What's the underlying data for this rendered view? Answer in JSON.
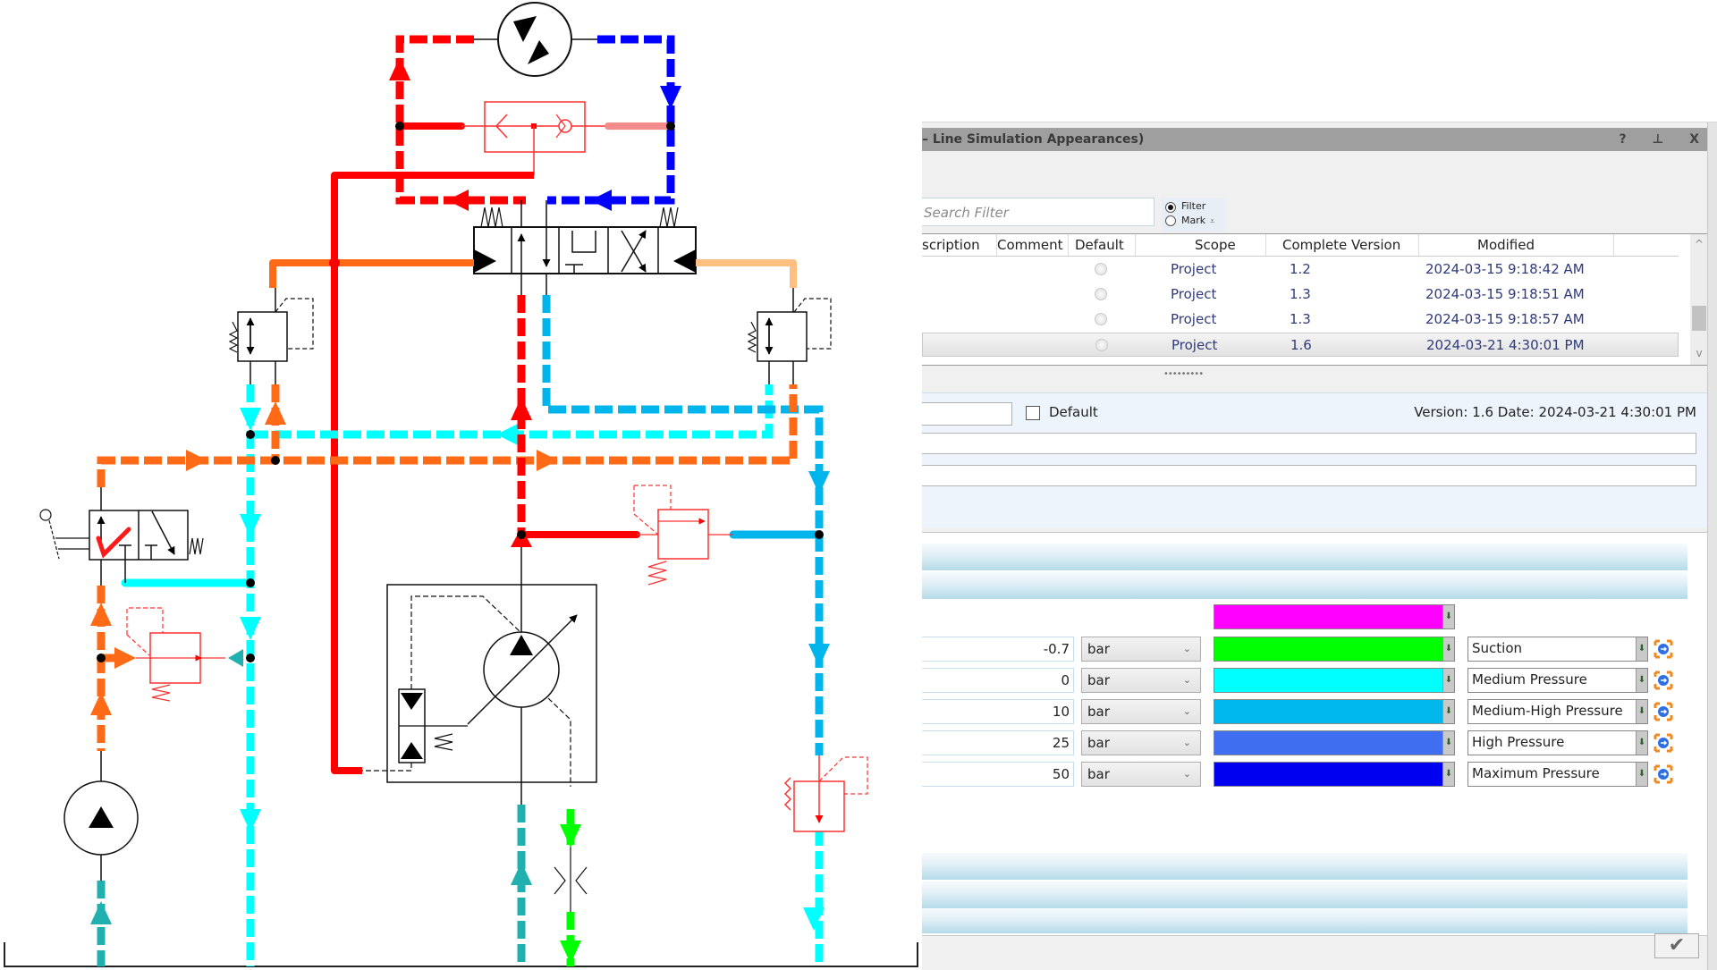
{
  "panel": {
    "title": "– Line Simulation Appearances)",
    "title_buttons": {
      "help": "?",
      "pin": "⊥",
      "close": "X"
    },
    "search": {
      "placeholder": "Search Filter"
    },
    "search_mode": {
      "filter_label": "Filter",
      "mark_label": "Mark",
      "selected": "Filter",
      "more_glyph": "⩡"
    },
    "grid": {
      "columns": [
        "scription",
        "Comment",
        "Default",
        "Scope",
        "Complete Version",
        "Modified"
      ],
      "rows": [
        {
          "default": false,
          "scope": "Project",
          "version": "1.2",
          "modified": "2024-03-15 9:18:42 AM",
          "selected": false
        },
        {
          "default": false,
          "scope": "Project",
          "version": "1.3",
          "modified": "2024-03-15 9:18:51 AM",
          "selected": false
        },
        {
          "default": false,
          "scope": "Project",
          "version": "1.3",
          "modified": "2024-03-15 9:18:57 AM",
          "selected": false
        },
        {
          "default": false,
          "scope": "Project",
          "version": "1.6",
          "modified": "2024-03-21 4:30:01 PM",
          "selected": true
        }
      ],
      "scroll_up": "^",
      "scroll_down": "v",
      "splitter": "•••••••••"
    },
    "detail": {
      "name_value": "",
      "default_label": "Default",
      "default_checked": false,
      "version_text": "Version:  1.6  Date:  2024-03-21 4:30:01 PM",
      "field1_value": "",
      "field2_value": ""
    },
    "top_color": "#ff00ff",
    "pressure_levels": [
      {
        "value": "-0.7",
        "unit": "bar",
        "color": "#00ff00",
        "label": "Suction"
      },
      {
        "value": "0",
        "unit": "bar",
        "color": "#00ffff",
        "label": "Medium Pressure"
      },
      {
        "value": "10",
        "unit": "bar",
        "color": "#00b8ec",
        "label": "Medium-High Pressure"
      },
      {
        "value": "25",
        "unit": "bar",
        "color": "#3f6ef0",
        "label": "High Pressure"
      },
      {
        "value": "50",
        "unit": "bar",
        "color": "#0000f0",
        "label": "Maximum Pressure"
      }
    ],
    "dropdown_glyph": "⬇",
    "unit_chevron": "⌄",
    "ok_glyph": "✔"
  },
  "diagram": {
    "line_colors": {
      "red": "#ff0000",
      "blue": "#0000ff",
      "orange": "#ff6a17",
      "light_orange": "#ffbf80",
      "cyan": "#00ffff",
      "sky": "#00b4ec",
      "teal": "#20b0b0",
      "green": "#00ff00",
      "pink": "#f58a8a"
    }
  }
}
